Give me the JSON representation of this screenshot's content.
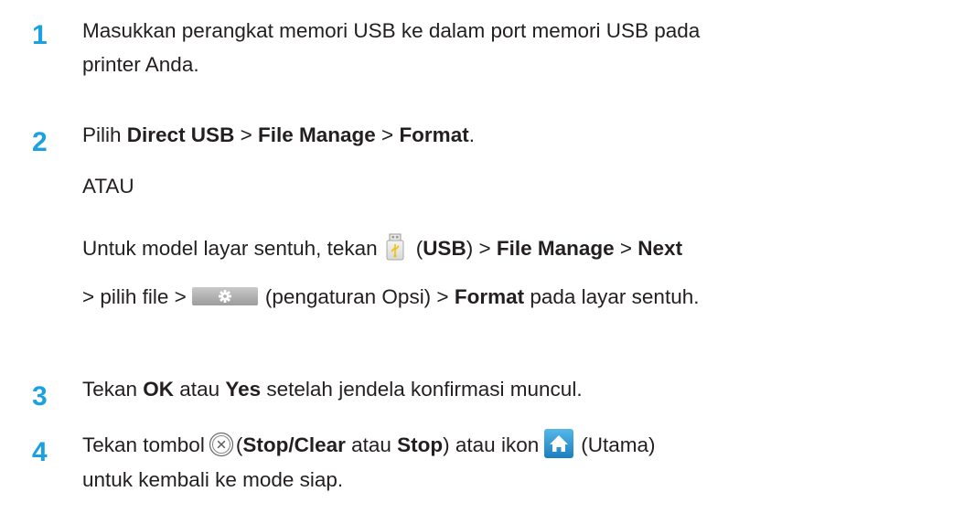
{
  "steps": [
    {
      "number": "1",
      "line1": "Masukkan perangkat memori USB ke dalam port memori USB pada",
      "line2": "printer Anda."
    },
    {
      "number": "2",
      "prefix": "Pilih ",
      "direct_usb": "Direct USB",
      "sep1": " > ",
      "file_manage": "File Manage",
      "sep2": " > ",
      "format": "Format",
      "end": ".",
      "or_text": "ATAU",
      "touch_prefix": "Untuk model layar sentuh, tekan",
      "usb_open": "(",
      "usb_label": "USB",
      "usb_close": ") > ",
      "file_manage2": "File Manage",
      "sep3": " > ",
      "next": "Next",
      "line4_prefix": "> pilih file >",
      "option_text": "(pengaturan Opsi) > ",
      "format2": "Format",
      "line4_suffix": " pada layar sentuh."
    },
    {
      "number": "3",
      "prefix": "Tekan ",
      "ok": "OK",
      "mid": " atau ",
      "yes": "Yes",
      "suffix": " setelah jendela konfirmasi muncul."
    },
    {
      "number": "4",
      "prefix": "Tekan tombol",
      "open": "(",
      "stop_clear": "Stop/Clear",
      "mid": " atau ",
      "stop": "Stop",
      "mid2": ") atau ikon",
      "home_text": "(Utama)",
      "line2": "untuk kembali ke mode siap."
    }
  ],
  "icons": {
    "usb": "usb-icon",
    "options": "settings-gear-icon",
    "stop": "stop-clear-icon",
    "home": "home-icon"
  },
  "colors": {
    "step_number": "#1ba1e2",
    "text": "#231f20"
  }
}
